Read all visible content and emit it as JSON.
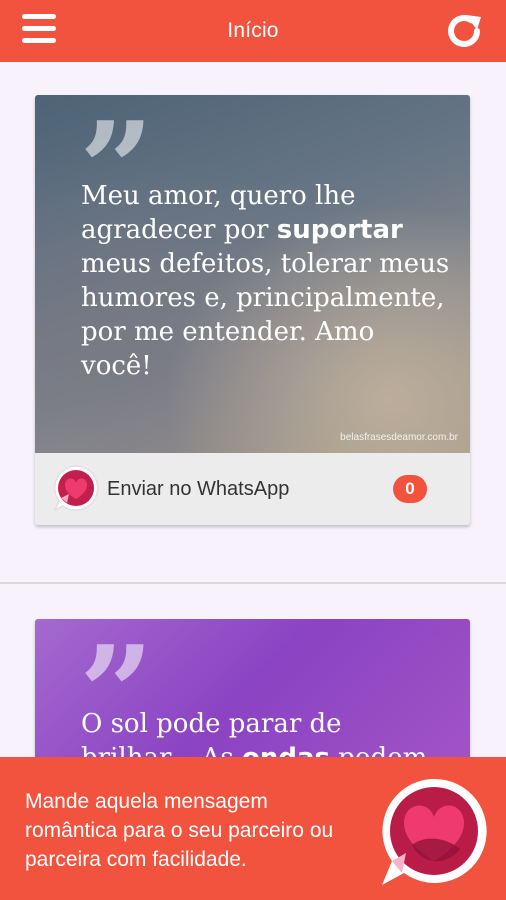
{
  "appbar": {
    "title": "Início",
    "menu_icon": "menu-icon",
    "refresh_icon": "refresh-icon"
  },
  "cards": [
    {
      "quote_icon": "quote-icon",
      "text_before": "Meu amor, quero lhe agradecer por ",
      "text_bold": "suportar",
      "text_after": " meus defeitos, tolerar meus humores e, principalmente, por me entender. Amo você!",
      "watermark": "belasfrasesdeamor.com.br",
      "send_label": "Enviar no WhatsApp",
      "count": "0"
    },
    {
      "quote_icon": "quote-icon",
      "text_before": "O sol pode parar de brilhar... As ",
      "text_bold": "ondas",
      "text_after": " podem deixar de"
    }
  ],
  "promo": {
    "text": "Mande aquela mensagem romântica para o seu parceiro ou parceira com facilidade.",
    "logo_icon": "app-logo-icon"
  },
  "colors": {
    "primary": "#f1533f",
    "background": "#f7f2fb"
  }
}
